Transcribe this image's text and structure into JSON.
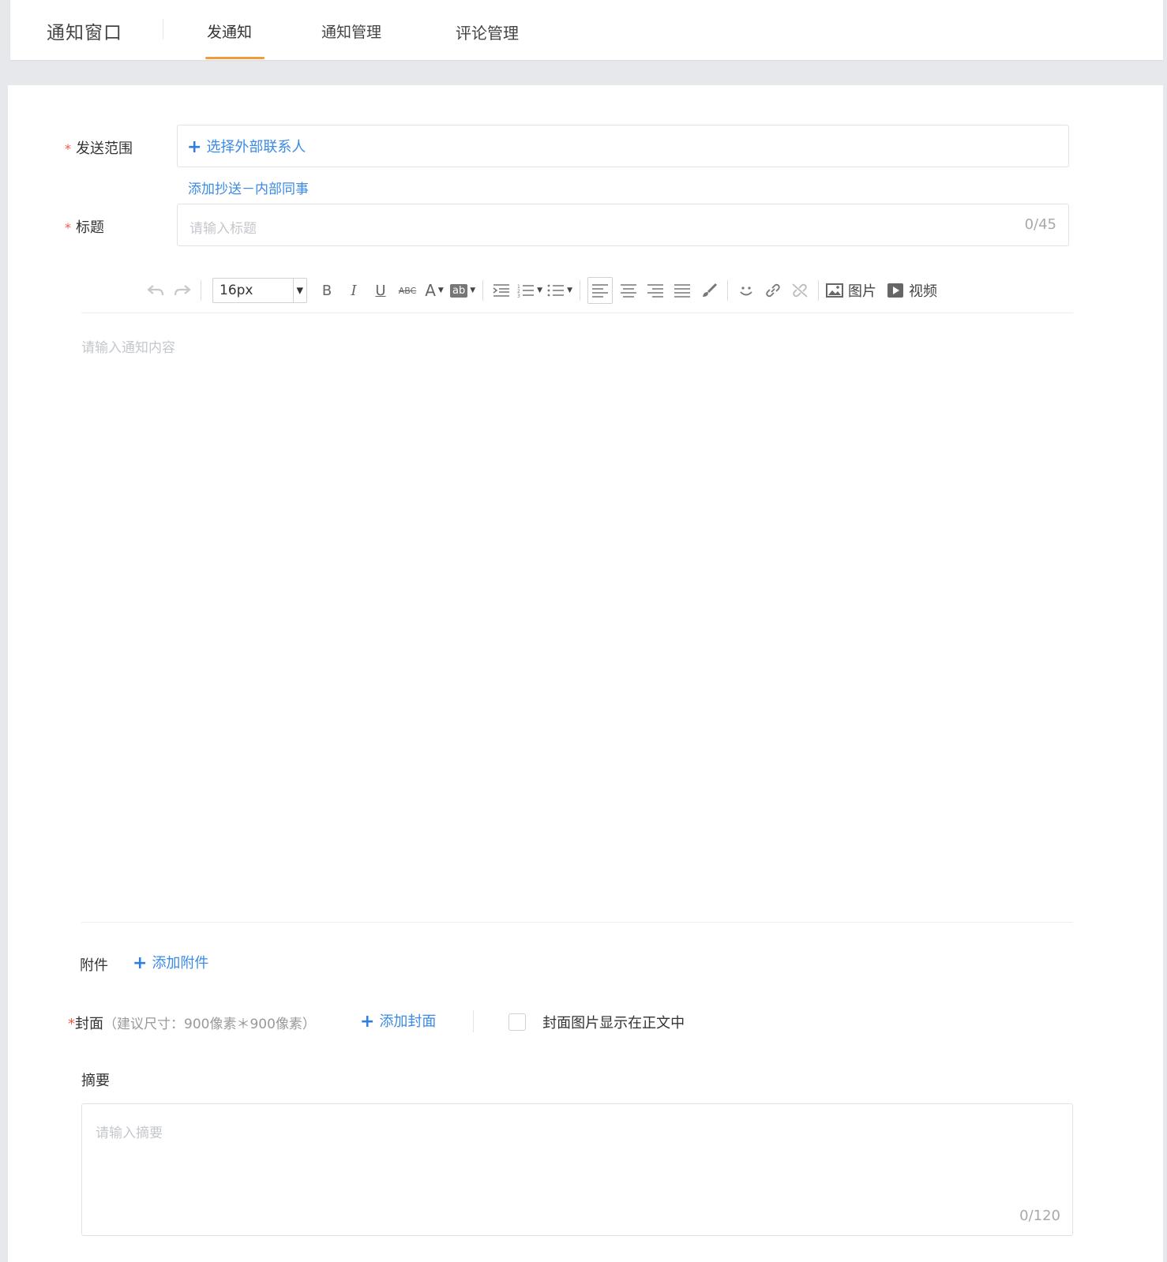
{
  "header": {
    "app_title": "通知窗口",
    "tabs": [
      {
        "label": "发通知",
        "active": true
      },
      {
        "label": "通知管理",
        "active": false
      },
      {
        "label": "评论管理",
        "active": false
      }
    ]
  },
  "form": {
    "scope": {
      "label": "发送范围",
      "required_mark": "*",
      "select_button": "选择外部联系人",
      "cc_link": "添加抄送－内部同事"
    },
    "title": {
      "label": "标题",
      "required_mark": "*",
      "placeholder": "请输入标题",
      "counter": "0/45"
    },
    "editor": {
      "font_size": "16px",
      "bold": "B",
      "italic": "I",
      "underline": "U",
      "strike": "ABC",
      "font_color": "A",
      "bg_color": "ab",
      "image_label": "图片",
      "video_label": "视频",
      "placeholder": "请输入通知内容"
    },
    "attachment": {
      "label": "附件",
      "add_button": "添加附件"
    },
    "cover": {
      "required_mark": "*",
      "label": "封面",
      "hint": "（建议尺寸：900像素＊900像素）",
      "add_button": "添加封面",
      "checkbox_label": "封面图片显示在正文中",
      "checkbox_checked": false
    },
    "summary": {
      "label": "摘要",
      "placeholder": "请输入摘要",
      "counter": "0/120"
    }
  },
  "colors": {
    "accent_orange": "#f39a3d",
    "link_blue": "#3b8ae6",
    "required_red": "#f25a4a",
    "background": "#e7e8ec"
  }
}
